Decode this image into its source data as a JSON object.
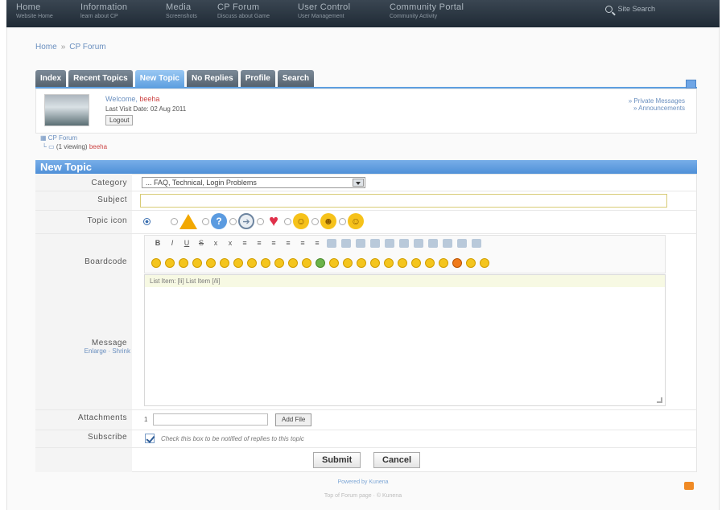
{
  "topnav": {
    "items": [
      {
        "title": "Home",
        "sub": "Website Home"
      },
      {
        "title": "Information",
        "sub": "learn about CP"
      },
      {
        "title": "Media",
        "sub": "Screenshots"
      },
      {
        "title": "CP Forum",
        "sub": "Discuss about Game"
      },
      {
        "title": "User Control",
        "sub": "User Management"
      },
      {
        "title": "Community Portal",
        "sub": "Community Activity"
      }
    ],
    "search_label": "Site Search"
  },
  "breadcrumb": {
    "home": "Home",
    "sep": "»",
    "current": "CP Forum"
  },
  "tabs": [
    "Index",
    "Recent Topics",
    "New Topic",
    "No Replies",
    "Profile",
    "Search"
  ],
  "user": {
    "welcome_prefix": "Welcome,",
    "username": "beeha",
    "last_visit": "Last Visit Date: 02 Aug 2011",
    "logout": "Logout",
    "private_messages": "» Private Messages",
    "announcements": "» Announcements"
  },
  "forumtree": {
    "forum": "CP Forum",
    "viewing": "(1 viewing)",
    "user": "beeha"
  },
  "new_topic": {
    "title": "New Topic",
    "labels": {
      "category": "Category",
      "subject": "Subject",
      "topic_icon": "Topic icon",
      "boardcode": "Boardcode",
      "message": "Message",
      "attachments": "Attachments",
      "subscribe": "Subscribe"
    },
    "category_value": "... FAQ, Technical, Login Problems",
    "message_sub": "Enlarge · Shrink",
    "prefill": "List Item: [li] List Item [/li]",
    "attach_num": "1",
    "add_file": "Add File",
    "subscribe_text": "Check this box to be notified of replies to this topic",
    "submit": "Submit",
    "cancel": "Cancel"
  },
  "toolbar_buttons": [
    "B",
    "I",
    "U",
    "S",
    "x",
    "x",
    "≡",
    "≡",
    "≡",
    "≡",
    "≡",
    "≡"
  ],
  "footer": {
    "powered": "Powered by Kunena",
    "bottom": "Top of Forum page · © Kunena"
  }
}
